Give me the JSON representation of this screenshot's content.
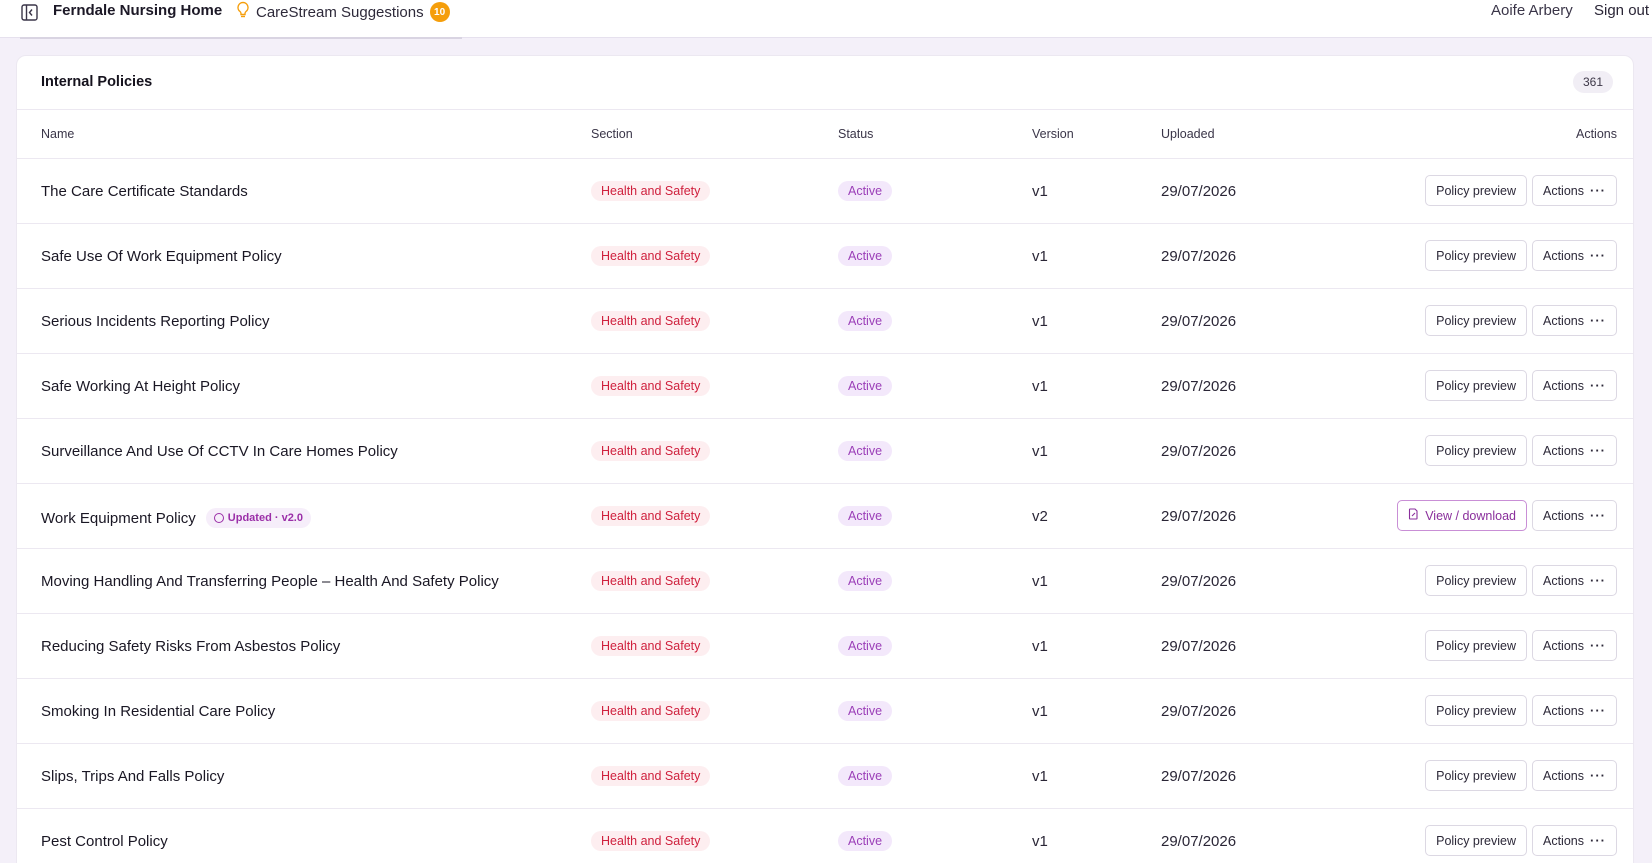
{
  "topbar": {
    "org_name": "Ferndale Nursing Home",
    "suggestions_label": "CareStream Suggestions",
    "suggestions_count": "10",
    "user_name": "Aoife Arbery",
    "sign_out": "Sign out"
  },
  "card": {
    "title": "Internal Policies",
    "count": "361"
  },
  "columns": {
    "name": "Name",
    "section": "Section",
    "status": "Status",
    "version": "Version",
    "uploaded": "Uploaded",
    "actions": "Actions"
  },
  "colors": {
    "accent": "#9b2fa8",
    "section_badge_bg": "#fdeef0",
    "section_badge_text": "#cf1f3c",
    "status_badge_bg": "#f3e8fb",
    "suggestion_badge": "#f59e0b"
  },
  "rows": [
    {
      "name": "The Care Certificate Standards",
      "section": "Health and Safety",
      "status": "Active",
      "version": "v1",
      "uploaded": "29/07/2026",
      "primary_action": "Policy preview",
      "secondary_action": "Actions"
    },
    {
      "name": "Safe Use Of Work Equipment Policy",
      "section": "Health and Safety",
      "status": "Active",
      "version": "v1",
      "uploaded": "29/07/2026",
      "primary_action": "Policy preview",
      "secondary_action": "Actions"
    },
    {
      "name": "Serious Incidents Reporting Policy",
      "section": "Health and Safety",
      "status": "Active",
      "version": "v1",
      "uploaded": "29/07/2026",
      "primary_action": "Policy preview",
      "secondary_action": "Actions"
    },
    {
      "name": "Safe Working At Height Policy",
      "section": "Health and Safety",
      "status": "Active",
      "version": "v1",
      "uploaded": "29/07/2026",
      "primary_action": "Policy preview",
      "secondary_action": "Actions"
    },
    {
      "name": "Surveillance And Use Of CCTV In Care Homes Policy",
      "section": "Health and Safety",
      "status": "Active",
      "version": "v1",
      "uploaded": "29/07/2026",
      "primary_action": "Policy preview",
      "secondary_action": "Actions"
    },
    {
      "name": "Work Equipment Policy",
      "updated_badge": "Updated · v2.0",
      "section": "Health and Safety",
      "status": "Active",
      "version": "v2",
      "uploaded": "29/07/2026",
      "primary_action": "View / download",
      "secondary_action": "Actions"
    },
    {
      "name": "Moving Handling And Transferring People – Health And Safety Policy",
      "section": "Health and Safety",
      "status": "Active",
      "version": "v1",
      "uploaded": "29/07/2026",
      "primary_action": "Policy preview",
      "secondary_action": "Actions"
    },
    {
      "name": "Reducing Safety Risks From Asbestos Policy",
      "section": "Health and Safety",
      "status": "Active",
      "version": "v1",
      "uploaded": "29/07/2026",
      "primary_action": "Policy preview",
      "secondary_action": "Actions"
    },
    {
      "name": "Smoking In Residential Care Policy",
      "section": "Health and Safety",
      "status": "Active",
      "version": "v1",
      "uploaded": "29/07/2026",
      "primary_action": "Policy preview",
      "secondary_action": "Actions"
    },
    {
      "name": "Slips, Trips And Falls Policy",
      "section": "Health and Safety",
      "status": "Active",
      "version": "v1",
      "uploaded": "29/07/2026",
      "primary_action": "Policy preview",
      "secondary_action": "Actions"
    },
    {
      "name": "Pest Control Policy",
      "section": "Health and Safety",
      "status": "Active",
      "version": "v1",
      "uploaded": "29/07/2026",
      "primary_action": "Policy preview",
      "secondary_action": "Actions"
    }
  ]
}
